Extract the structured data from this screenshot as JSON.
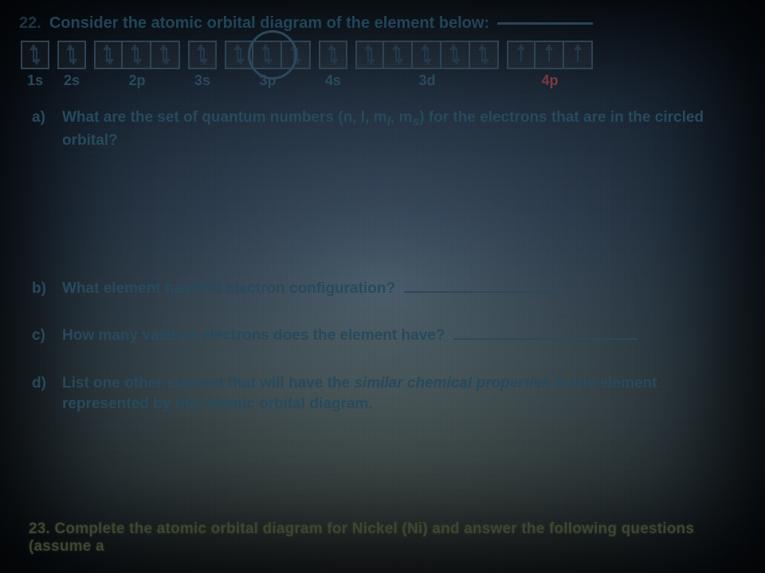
{
  "question": {
    "number": "22.",
    "title": "Consider the atomic orbital diagram of the element below:"
  },
  "orbitals": [
    {
      "label": "1s",
      "color": "normal",
      "boxes": [
        [
          "up",
          "down"
        ]
      ]
    },
    {
      "label": "2s",
      "color": "normal",
      "boxes": [
        [
          "up",
          "down"
        ]
      ]
    },
    {
      "label": "2p",
      "color": "normal",
      "boxes": [
        [
          "up",
          "down"
        ],
        [
          "up",
          "down"
        ],
        [
          "up",
          "down"
        ]
      ]
    },
    {
      "label": "3s",
      "color": "normal",
      "boxes": [
        [
          "up",
          "down"
        ]
      ],
      "circled": true
    },
    {
      "label": "3p",
      "color": "normal",
      "boxes": [
        [
          "up",
          "down"
        ],
        [
          "up",
          "down"
        ],
        [
          "up",
          "down"
        ]
      ]
    },
    {
      "label": "4s",
      "color": "normal",
      "boxes": [
        [
          "up",
          "down"
        ]
      ]
    },
    {
      "label": "3d",
      "color": "normal",
      "boxes": [
        [
          "up",
          "down"
        ],
        [
          "up",
          "down"
        ],
        [
          "up",
          "down"
        ],
        [
          "up",
          "down"
        ],
        [
          "up",
          "down"
        ]
      ]
    },
    {
      "label": "4p",
      "color": "red",
      "boxes": [
        [
          "up"
        ],
        [
          "up"
        ],
        [
          "up"
        ]
      ]
    }
  ],
  "subquestions": {
    "a": {
      "letter": "a)",
      "pre": "What are the set of quantum numbers (n, l, m",
      "sub1": "l",
      "mid": ", m",
      "sub2": "s",
      "post": ") for the electrons that are in the circled orbital?"
    },
    "b": {
      "letter": "b)",
      "text": "What element has this electron configuration?"
    },
    "c": {
      "letter": "c)",
      "text": "How many valence electrons does the element have?"
    },
    "d": {
      "letter": "d)",
      "text_pre": "List one other element that will have the ",
      "italic": "similar chemical properties",
      "text_post": " to the element represented by this atomic orbital diagram."
    }
  },
  "next_question": "23.  Complete the atomic orbital diagram for Nickel (Ni) and answer the following questions (assume a"
}
